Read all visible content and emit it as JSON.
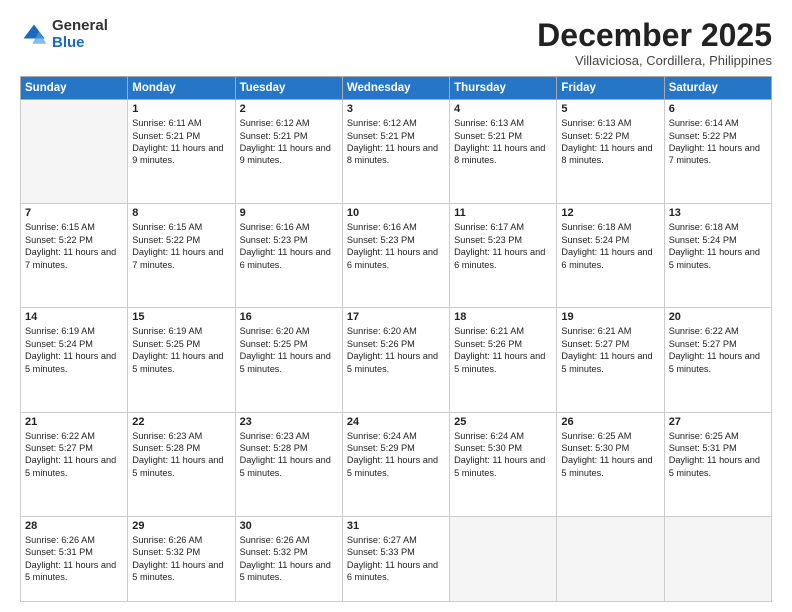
{
  "logo": {
    "general": "General",
    "blue": "Blue"
  },
  "header": {
    "month": "December 2025",
    "location": "Villaviciosa, Cordillera, Philippines"
  },
  "weekdays": [
    "Sunday",
    "Monday",
    "Tuesday",
    "Wednesday",
    "Thursday",
    "Friday",
    "Saturday"
  ],
  "weeks": [
    [
      {
        "day": "",
        "empty": true
      },
      {
        "day": "1",
        "sunrise": "6:11 AM",
        "sunset": "5:21 PM",
        "daylight": "11 hours and 9 minutes."
      },
      {
        "day": "2",
        "sunrise": "6:12 AM",
        "sunset": "5:21 PM",
        "daylight": "11 hours and 9 minutes."
      },
      {
        "day": "3",
        "sunrise": "6:12 AM",
        "sunset": "5:21 PM",
        "daylight": "11 hours and 8 minutes."
      },
      {
        "day": "4",
        "sunrise": "6:13 AM",
        "sunset": "5:21 PM",
        "daylight": "11 hours and 8 minutes."
      },
      {
        "day": "5",
        "sunrise": "6:13 AM",
        "sunset": "5:22 PM",
        "daylight": "11 hours and 8 minutes."
      },
      {
        "day": "6",
        "sunrise": "6:14 AM",
        "sunset": "5:22 PM",
        "daylight": "11 hours and 7 minutes."
      }
    ],
    [
      {
        "day": "7",
        "sunrise": "6:15 AM",
        "sunset": "5:22 PM",
        "daylight": "11 hours and 7 minutes."
      },
      {
        "day": "8",
        "sunrise": "6:15 AM",
        "sunset": "5:22 PM",
        "daylight": "11 hours and 7 minutes."
      },
      {
        "day": "9",
        "sunrise": "6:16 AM",
        "sunset": "5:23 PM",
        "daylight": "11 hours and 6 minutes."
      },
      {
        "day": "10",
        "sunrise": "6:16 AM",
        "sunset": "5:23 PM",
        "daylight": "11 hours and 6 minutes."
      },
      {
        "day": "11",
        "sunrise": "6:17 AM",
        "sunset": "5:23 PM",
        "daylight": "11 hours and 6 minutes."
      },
      {
        "day": "12",
        "sunrise": "6:18 AM",
        "sunset": "5:24 PM",
        "daylight": "11 hours and 6 minutes."
      },
      {
        "day": "13",
        "sunrise": "6:18 AM",
        "sunset": "5:24 PM",
        "daylight": "11 hours and 5 minutes."
      }
    ],
    [
      {
        "day": "14",
        "sunrise": "6:19 AM",
        "sunset": "5:24 PM",
        "daylight": "11 hours and 5 minutes."
      },
      {
        "day": "15",
        "sunrise": "6:19 AM",
        "sunset": "5:25 PM",
        "daylight": "11 hours and 5 minutes."
      },
      {
        "day": "16",
        "sunrise": "6:20 AM",
        "sunset": "5:25 PM",
        "daylight": "11 hours and 5 minutes."
      },
      {
        "day": "17",
        "sunrise": "6:20 AM",
        "sunset": "5:26 PM",
        "daylight": "11 hours and 5 minutes."
      },
      {
        "day": "18",
        "sunrise": "6:21 AM",
        "sunset": "5:26 PM",
        "daylight": "11 hours and 5 minutes."
      },
      {
        "day": "19",
        "sunrise": "6:21 AM",
        "sunset": "5:27 PM",
        "daylight": "11 hours and 5 minutes."
      },
      {
        "day": "20",
        "sunrise": "6:22 AM",
        "sunset": "5:27 PM",
        "daylight": "11 hours and 5 minutes."
      }
    ],
    [
      {
        "day": "21",
        "sunrise": "6:22 AM",
        "sunset": "5:27 PM",
        "daylight": "11 hours and 5 minutes."
      },
      {
        "day": "22",
        "sunrise": "6:23 AM",
        "sunset": "5:28 PM",
        "daylight": "11 hours and 5 minutes."
      },
      {
        "day": "23",
        "sunrise": "6:23 AM",
        "sunset": "5:28 PM",
        "daylight": "11 hours and 5 minutes."
      },
      {
        "day": "24",
        "sunrise": "6:24 AM",
        "sunset": "5:29 PM",
        "daylight": "11 hours and 5 minutes."
      },
      {
        "day": "25",
        "sunrise": "6:24 AM",
        "sunset": "5:30 PM",
        "daylight": "11 hours and 5 minutes."
      },
      {
        "day": "26",
        "sunrise": "6:25 AM",
        "sunset": "5:30 PM",
        "daylight": "11 hours and 5 minutes."
      },
      {
        "day": "27",
        "sunrise": "6:25 AM",
        "sunset": "5:31 PM",
        "daylight": "11 hours and 5 minutes."
      }
    ],
    [
      {
        "day": "28",
        "sunrise": "6:26 AM",
        "sunset": "5:31 PM",
        "daylight": "11 hours and 5 minutes."
      },
      {
        "day": "29",
        "sunrise": "6:26 AM",
        "sunset": "5:32 PM",
        "daylight": "11 hours and 5 minutes."
      },
      {
        "day": "30",
        "sunrise": "6:26 AM",
        "sunset": "5:32 PM",
        "daylight": "11 hours and 5 minutes."
      },
      {
        "day": "31",
        "sunrise": "6:27 AM",
        "sunset": "5:33 PM",
        "daylight": "11 hours and 6 minutes."
      },
      {
        "day": "",
        "empty": true
      },
      {
        "day": "",
        "empty": true
      },
      {
        "day": "",
        "empty": true
      }
    ]
  ]
}
